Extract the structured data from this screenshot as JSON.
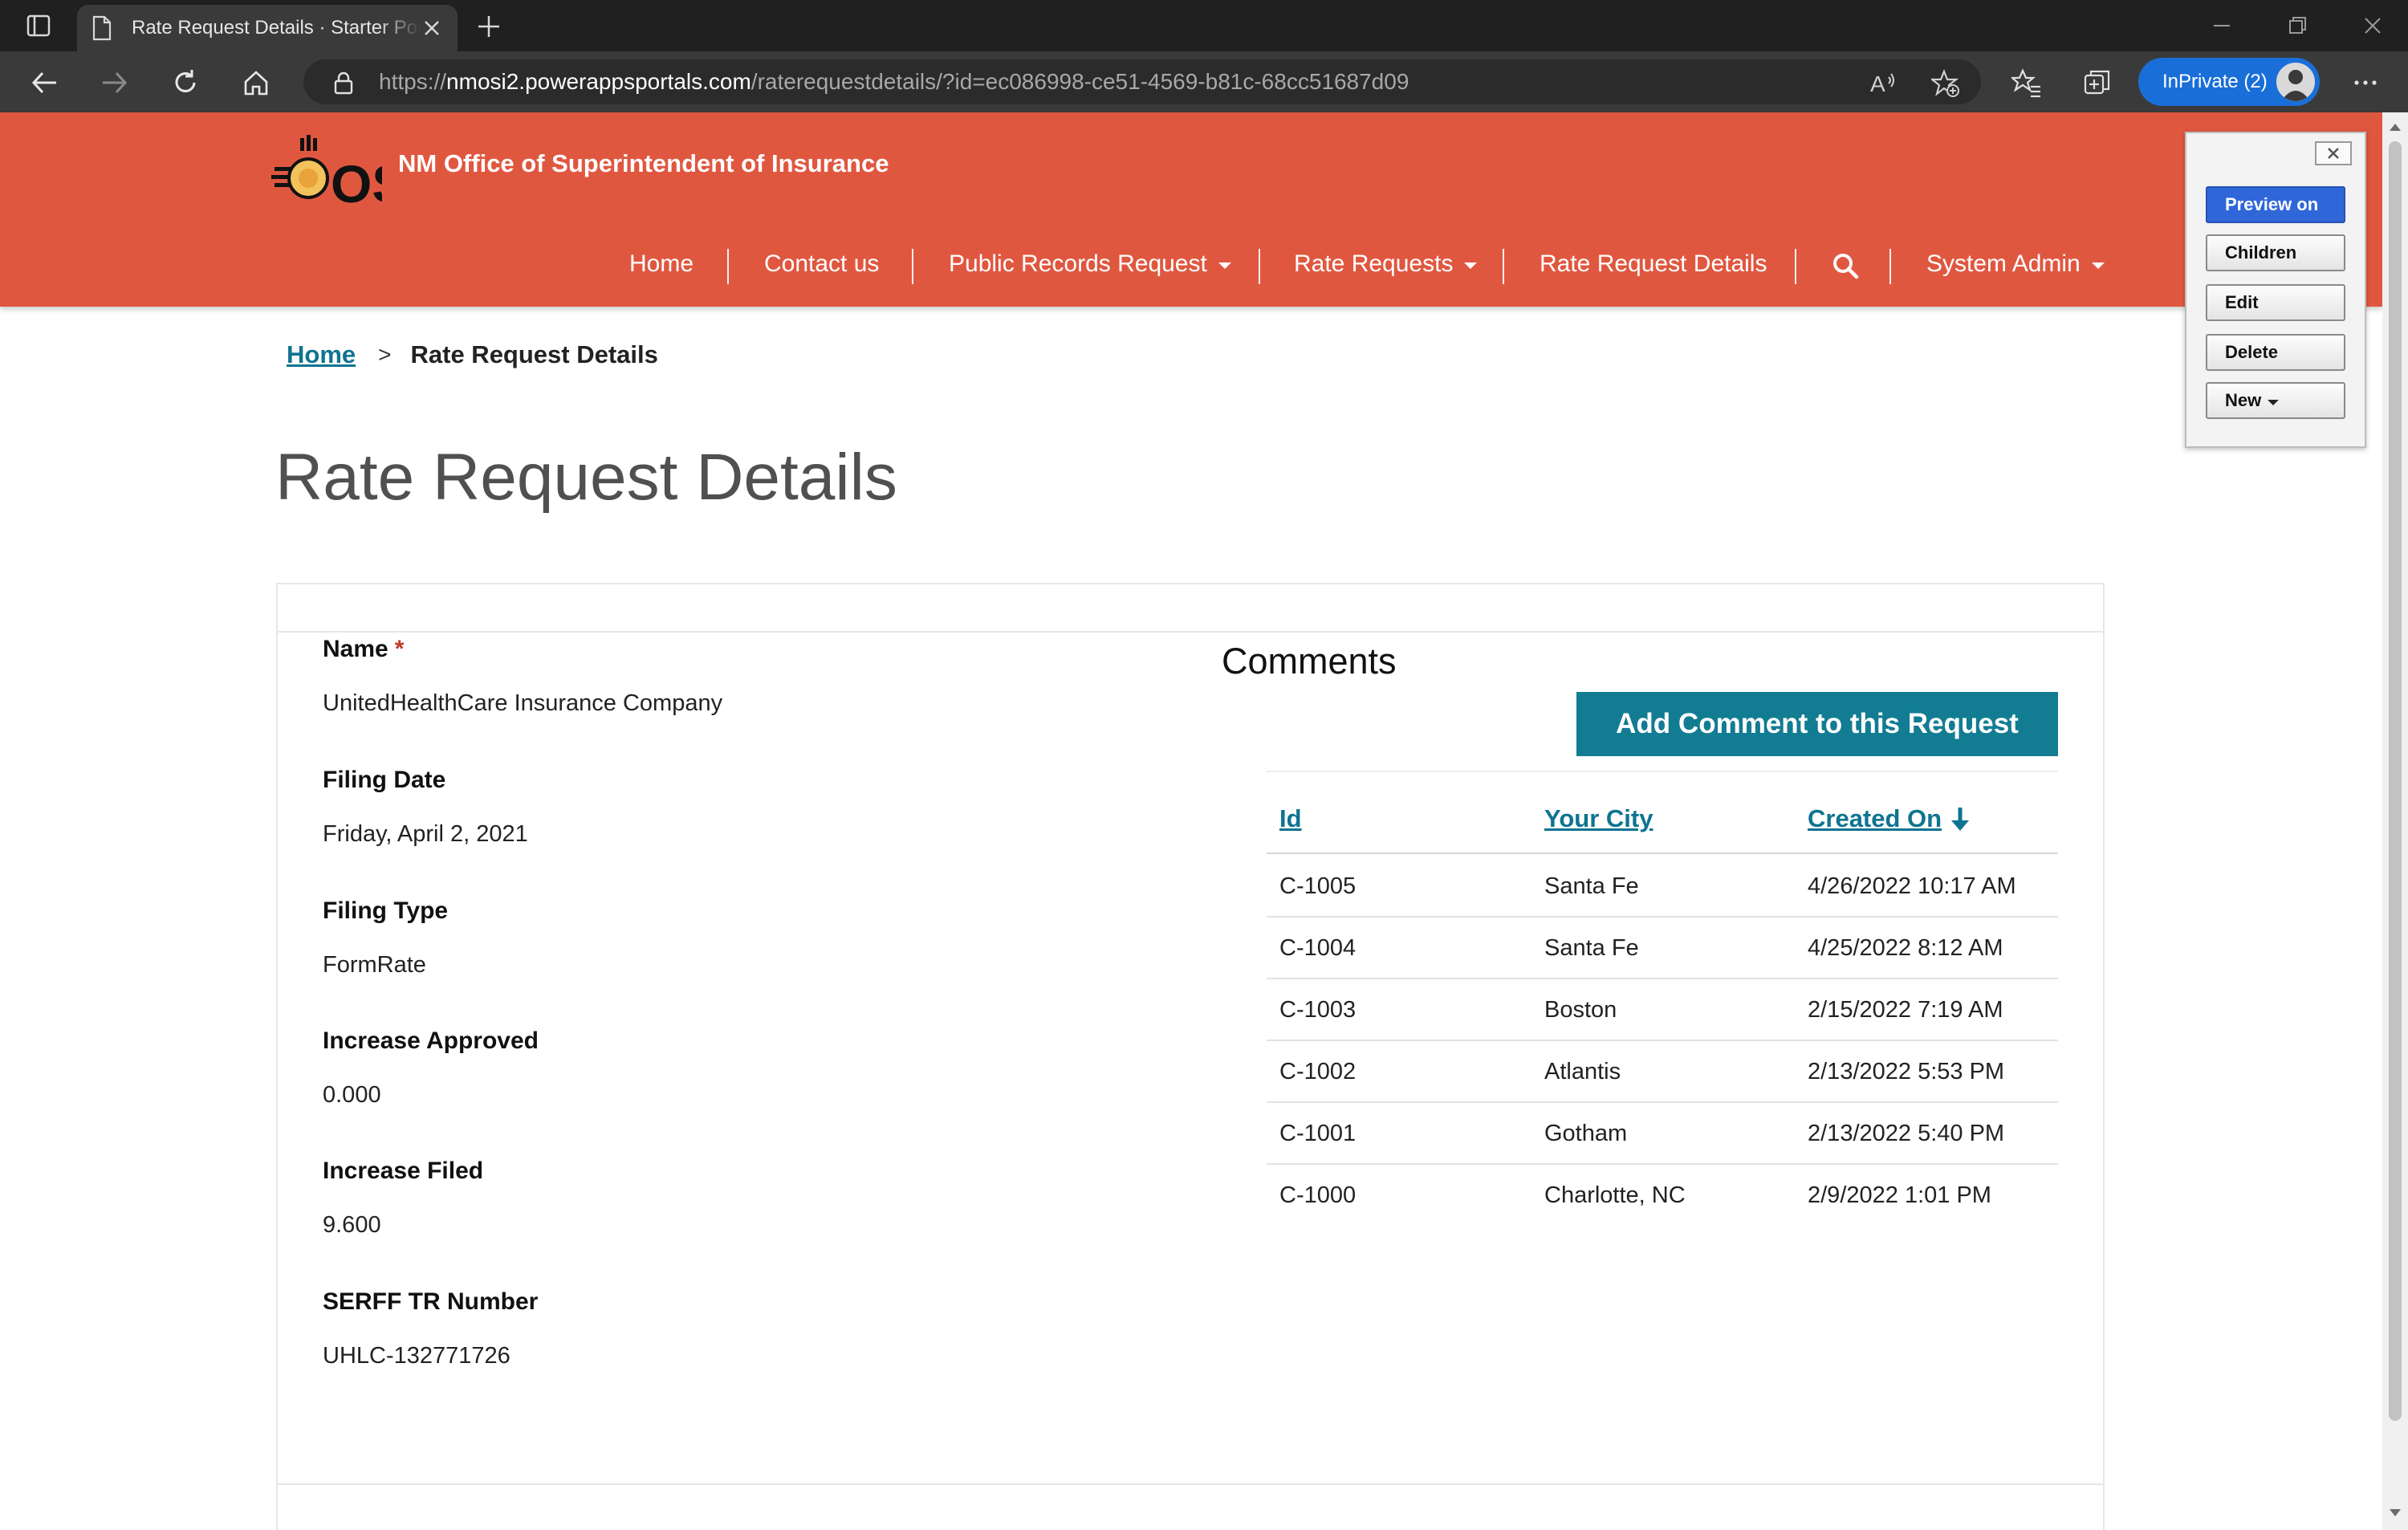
{
  "browser": {
    "tab_title": "Rate Request Details · Starter Portal",
    "url_prefix": "https://",
    "url_host": "nmosi2.powerappsportals.com",
    "url_path": "/raterequestdetails/?id=ec086998-ce51-4569-b81c-68cc51687d09",
    "inprivate_label": "InPrivate (2)"
  },
  "site": {
    "title": "NM Office of Superintendent of Insurance",
    "logo_text": "OSI",
    "nav": {
      "home": "Home",
      "contact": "Contact us",
      "public_records": "Public Records Request",
      "rate_requests": "Rate Requests",
      "rate_request_details": "Rate Request Details",
      "system_admin": "System Admin"
    }
  },
  "admin_panel": {
    "close": "✕",
    "preview": "Preview on",
    "children": "Children",
    "edit": "Edit",
    "delete": "Delete",
    "new": "New"
  },
  "breadcrumb": {
    "home": "Home",
    "separator": ">",
    "current": "Rate Request Details"
  },
  "page": {
    "title": "Rate Request Details"
  },
  "form": {
    "fields": [
      {
        "label": "Name",
        "required": "*",
        "value": "UnitedHealthCare Insurance Company"
      },
      {
        "label": "Filing Date",
        "value": "Friday, April 2, 2021"
      },
      {
        "label": "Filing Type",
        "value": "FormRate"
      },
      {
        "label": "Increase Approved",
        "value": "0.000"
      },
      {
        "label": "Increase Filed",
        "value": "9.600"
      },
      {
        "label": "SERFF TR Number",
        "value": "UHLC-132771726"
      }
    ]
  },
  "comments": {
    "heading": "Comments",
    "add_button": "Add Comment to this Request",
    "columns": [
      "Id",
      "Your City",
      "Created On"
    ],
    "rows": [
      [
        "C-1005",
        "Santa Fe",
        "4/26/2022 10:17 AM"
      ],
      [
        "C-1004",
        "Santa Fe",
        "4/25/2022 8:12 AM"
      ],
      [
        "C-1003",
        "Boston",
        "2/15/2022 7:19 AM"
      ],
      [
        "C-1002",
        "Atlantis",
        "2/13/2022 5:53 PM"
      ],
      [
        "C-1001",
        "Gotham",
        "2/13/2022 5:40 PM"
      ],
      [
        "C-1000",
        "Charlotte, NC",
        "2/9/2022 1:01 PM"
      ]
    ]
  },
  "colors": {
    "header_bg": "#e05740",
    "accent": "#127c93",
    "link": "#0e7490",
    "preview_button": "#2f67d8",
    "inprivate_badge": "#1a6ed8"
  }
}
